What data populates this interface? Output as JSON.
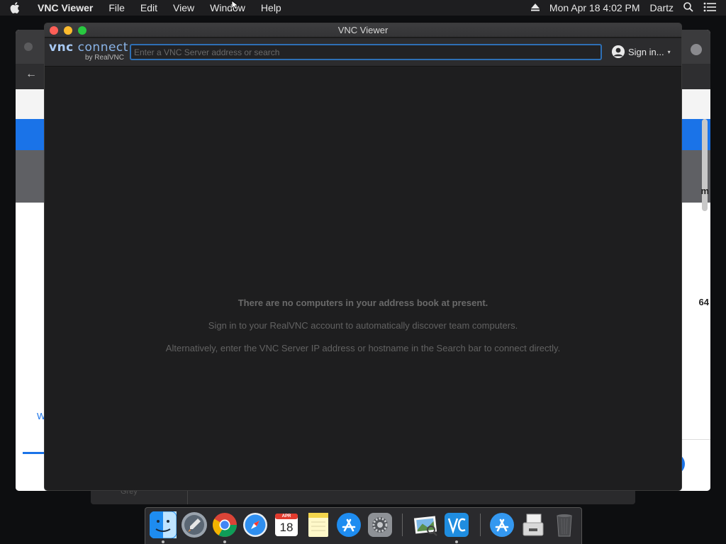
{
  "menubar": {
    "app_name": "VNC Viewer",
    "items": [
      "File",
      "Edit",
      "View",
      "Window",
      "Help"
    ],
    "datetime": "Mon Apr 18  4:02 PM",
    "user": "Dartz"
  },
  "background": {
    "right_text_1": "m",
    "right_text_2": "64",
    "tab_text": "W",
    "finder_item": "Grey"
  },
  "window": {
    "title": "VNC Viewer"
  },
  "toolbar": {
    "logo_text_1": "vnc",
    "logo_text_2": "connect",
    "logo_sub": "by RealVNC",
    "search_placeholder": "Enter a VNC Server address or search",
    "signin_label": "Sign in...",
    "signin_caret": "▾"
  },
  "content": {
    "empty_title": "There are no computers in your address book at present.",
    "empty_line2": "Sign in to your RealVNC account to automatically discover team computers.",
    "empty_line3": "Alternatively, enter the VNC Server IP address or hostname in the Search bar to connect directly."
  },
  "dock": {
    "items": [
      {
        "name": "finder",
        "running": true
      },
      {
        "name": "launchpad",
        "running": false
      },
      {
        "name": "chrome",
        "running": true
      },
      {
        "name": "safari",
        "running": false
      },
      {
        "name": "calendar",
        "running": false,
        "month": "APR",
        "day": "18"
      },
      {
        "name": "notes",
        "running": false
      },
      {
        "name": "app-store",
        "running": false
      },
      {
        "name": "system-preferences",
        "running": false
      },
      {
        "name": "preview",
        "running": false
      },
      {
        "name": "vnc-viewer",
        "running": true
      },
      {
        "name": "app-store-downloads",
        "running": false
      },
      {
        "name": "documents",
        "running": false
      },
      {
        "name": "trash",
        "running": false
      }
    ]
  },
  "colors": {
    "accent": "#2e6fb5",
    "background_blue": "#1a73e8"
  }
}
